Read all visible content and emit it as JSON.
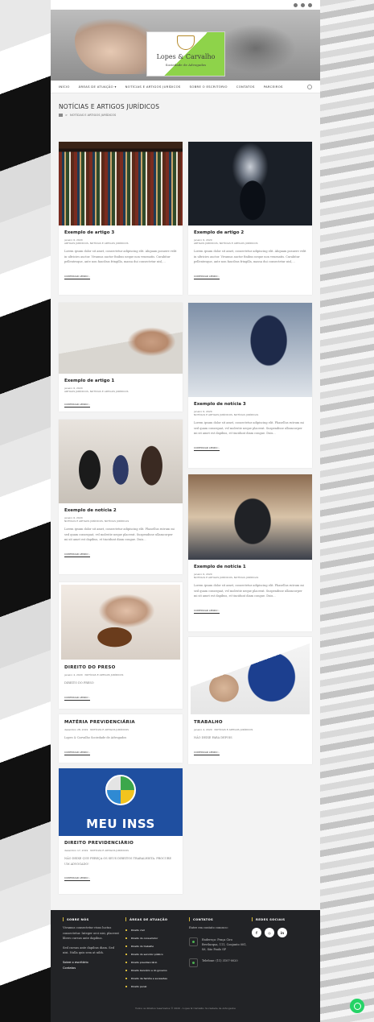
{
  "site": {
    "logo_name": "Lopes & Carvalho",
    "logo_sub": "Sociedade de Advogados"
  },
  "nav": {
    "items": [
      "INÍCIO",
      "ÁREAS DE ATUAÇÃO",
      "NOTÍCIAS E ARTIGOS JURÍDICOS",
      "SOBRE O ESCRITÓRIO",
      "CONTATOS",
      "PARCEIROS"
    ],
    "dropdown_marker": "▾"
  },
  "page": {
    "title": "NOTÍCIAS E ARTIGOS JURÍDICOS",
    "breadcrumb_sep": ">",
    "breadcrumb_current": "NOTÍCIAS E ARTIGOS JURÍDICOS"
  },
  "posts": [
    {
      "title": "Exemplo de artigo 3",
      "date": "janeiro 6, 2020",
      "cats": "ARTIGOS JURÍDICOS, NOTÍCIAS E ARTIGOS JURÍDICOS",
      "excerpt": "Lorem ipsum dolor sit amet, consectetur adipiscing elit. Aliquam posuere velit in ultricies auctor. Vivamus auctor finibus neque non venenatis. Curabitur pellentesque, ante non faucibus fringilla, massa dui consectetur nisl,...",
      "more": "CONTINUAR LENDO ›"
    },
    {
      "title": "Exemplo de artigo 2",
      "date": "janeiro 6, 2020",
      "cats": "ARTIGOS JURÍDICOS, NOTÍCIAS E ARTIGOS JURÍDICOS",
      "excerpt": "Lorem ipsum dolor sit amet, consectetur adipiscing elit. Aliquam posuere velit in ultricies auctor. Vivamus auctor finibus neque non venenatis. Curabitur pellentesque, ante non faucibus fringilla, massa dui consectetur nisl,...",
      "more": "CONTINUAR LENDO ›"
    },
    {
      "title": "Exemplo de artigo 1",
      "date": "janeiro 6, 2020",
      "cats": "ARTIGOS JURÍDICOS, NOTÍCIAS E ARTIGOS JURÍDICOS",
      "excerpt": "",
      "more": "CONTINUAR LENDO ›"
    },
    {
      "title": "Exemplo de notícia 3",
      "date": "janeiro 6, 2020",
      "cats": "NOTÍCIAS E ARTIGOS JURÍDICOS, NOTÍCIAS JURÍDICAS",
      "excerpt": "Lorem ipsum dolor sit amet, consectetur adipiscing elit. Phasellus rutrum mi sed quam consequat, vel molestie neque placerat. Suspendisse ullamcorper mi sit amet est dapibus, et tincidunt diam congue. Duis...",
      "more": "CONTINUAR LENDO ›"
    },
    {
      "title": "Exemplo de notícia 2",
      "date": "janeiro 6, 2020",
      "cats": "NOTÍCIAS E ARTIGOS JURÍDICOS, NOTÍCIAS JURÍDICAS",
      "excerpt": "Lorem ipsum dolor sit amet, consectetur adipiscing elit. Phasellus rutrum mi sed quam consequat, vel molestie neque placerat. Suspendisse ullamcorper mi sit amet est dapibus, et tincidunt diam congue. Duis...",
      "more": "CONTINUAR LENDO ›"
    },
    {
      "title": "Exemplo de notícia 1",
      "date": "janeiro 6, 2020",
      "cats": "NOTÍCIAS E ARTIGOS JURÍDICOS, NOTÍCIAS JURÍDICAS",
      "excerpt": "Lorem ipsum dolor sit amet, consectetur adipiscing elit. Phasellus rutrum mi sed quam consequat, vel molestie neque placerat. Suspendisse ullamcorper mi sit amet est dapibus, et tincidunt diam congue. Duis...",
      "more": "CONTINUAR LENDO ›"
    },
    {
      "title": "DIREITO DO PRESO",
      "date": "janeiro 4, 2020",
      "cats": "NOTÍCIAS E ARTIGOS JURÍDICOS",
      "excerpt": "DIREITO DO PRESO",
      "more": "CONTINUAR LENDO ›"
    },
    {
      "title": "TRABALHO",
      "date": "janeiro 4, 2020",
      "cats": "NOTÍCIAS E ARTIGOS JURÍDICOS",
      "excerpt": "NÃO DEIXE PARA DEPOIS",
      "more": "CONTINUAR LENDO ›"
    },
    {
      "title": "MATÉRIA PREVIDENCIÁRIA",
      "date": "dezembro 28, 2019",
      "cats": "NOTÍCIAS E ARTIGOS JURÍDICOS",
      "excerpt": "Lopes & Carvalho Sociedade de Advogados",
      "more": "CONTINUAR LENDO ›"
    },
    {
      "title": "DIREITO PREVIDENCIÁRIO",
      "date": "dezembro 17, 2019",
      "cats": "NOTÍCIAS E ARTIGOS JURÍDICOS",
      "excerpt": "NÃO DEIXE QUE PEREÇA OS SEUS DIREITOS TRABALHISTA. PROCURE UM ADVOGADO!",
      "more": "CONTINUAR LENDO ›",
      "image_text": "MEU INSS"
    }
  ],
  "footer": {
    "about_title": "SOBRE NÓS",
    "about_text1": "Vivamus consectetur risus luctus consectetur. Integer orci nisi, placerat libero cursus ante dapibus.",
    "about_text2": "Sed cursus ante dapibus diam. Sed nisi. Nulla quis sem at nibh.",
    "about_link1": "Sobre o escritório",
    "about_link2": "Contatos",
    "areas_title": "ÁREAS DE ATUAÇÃO",
    "areas": [
      "Direito civil",
      "Direito do consumidor",
      "Direito do trabalho",
      "Direito do servidor público",
      "Direito previdenciário",
      "Direito bancário e do governo",
      "Direito de família e sucessões",
      "Direito penal"
    ],
    "contacts_title": "CONTATOS",
    "contacts_intro": "Entre em contato conosco:",
    "address": "Endereço: Praça Ciro Bevilacqua, 111, Conjunto 081, Sé, São Paulo SP",
    "phone": "Telefone: (11) 3107-0020",
    "social_title": "REDES SOCIAIS",
    "social": [
      "f",
      "◎",
      "in"
    ],
    "copyright": "Todos os direitos reservados © 2020 - Lopes & Carvalho Sociedade de Advogados"
  }
}
